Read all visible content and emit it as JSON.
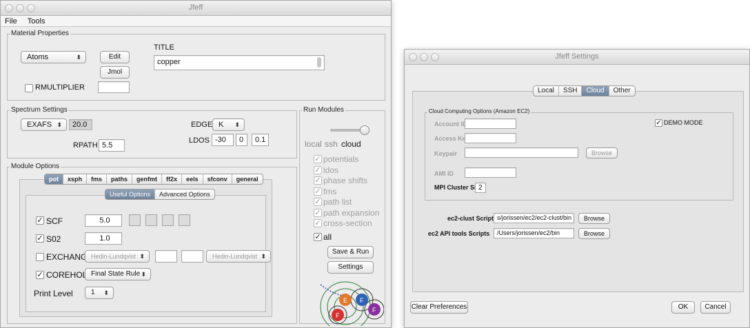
{
  "main_window": {
    "title": "Jfeff",
    "menu": [
      "File",
      "Tools"
    ],
    "material": {
      "group_label": "Material Properties",
      "atoms_popup": "Atoms",
      "edit_button": "Edit",
      "jmol_button": "Jmol",
      "title_label": "TITLE",
      "title_value": "copper",
      "rmultiplier_label": "RMULTIPLIER",
      "rmultiplier_value": ""
    },
    "spectrum": {
      "group_label": "Spectrum Settings",
      "spectrum_popup": "EXAFS",
      "spectrum_value": "20.0",
      "edge_label": "EDGE",
      "edge_popup": "K",
      "rpath_label": "RPATH",
      "rpath_value": "5.5",
      "ldos_label": "LDOS",
      "ldos_values": [
        "-30",
        "0",
        "0.1"
      ]
    },
    "module_options": {
      "group_label": "Module Options",
      "tabs": [
        "pot",
        "xsph",
        "fms",
        "paths",
        "genfmt",
        "ff2x",
        "eels",
        "sfconv",
        "general"
      ],
      "subtabs": [
        "Useful Options",
        "Advanced Options"
      ],
      "scf_label": "SCF",
      "scf_value": "5.0",
      "s02_label": "S02",
      "s02_value": "1.0",
      "exchange_label": "EXCHANGE",
      "exchange_popup1": "Hedin-Lundqvist",
      "exchange_popup2": "Hedin-Lundqvist",
      "corehole_label": "COREHOLE",
      "corehole_popup": "Final State Rule",
      "print_level_label": "Print Level",
      "print_level_value": "1"
    },
    "run_modules": {
      "group_label": "Run Modules",
      "mode_labels": [
        "local",
        "ssh",
        "cloud"
      ],
      "modules": [
        "potentials",
        "ldos",
        "phase shifts",
        "fms",
        "path list",
        "path expansion",
        "cross-section"
      ],
      "all_label": "all",
      "save_run_button": "Save & Run",
      "settings_button": "Settings",
      "logo_letters": [
        "E",
        "F",
        "F",
        "F"
      ]
    }
  },
  "settings_window": {
    "title": "Jfeff Settings",
    "tabs": [
      "Local",
      "SSH",
      "Cloud",
      "Other"
    ],
    "cloud": {
      "group_label": "Cloud Computing Options (Amazon EC2)",
      "account_id_label": "Account ID",
      "access_key_label": "Access Key",
      "keypair_label": "Keypair",
      "browse_label": "Browse",
      "ami_id_label": "AMI ID",
      "mpi_label": "MPI Cluster Size",
      "mpi_value": "2",
      "demo_mode_label": "DEMO MODE",
      "ec2_clust_label": "ec2-clust Scripts",
      "ec2_clust_value": "s/jorissen/ec2/ec2-clust/bin",
      "ec2_api_label": "ec2 API tools Scripts",
      "ec2_api_value": "/Users/jorissen/ec2/bin"
    },
    "clear_button": "Clear Preferences",
    "ok_button": "OK",
    "cancel_button": "Cancel"
  },
  "colors": {
    "selected_tab": "#7a8ea6",
    "logo_orange": "#e07a2b",
    "logo_blue": "#2f62b5",
    "logo_red": "#d63131",
    "logo_purple": "#8a2fa1",
    "ring_green": "#2f7d3a"
  }
}
